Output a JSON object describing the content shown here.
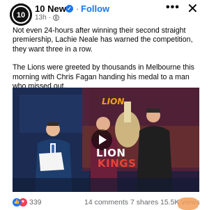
{
  "header": {
    "page_name": "10 News",
    "verified_mark": "✓",
    "separator": "·",
    "follow_label": "Follow",
    "timestamp": "13h",
    "timestamp_separator": "·",
    "logo_text": "10",
    "more_label": "•••",
    "close_label": "✕"
  },
  "post": {
    "paragraph_1": "Not even 24-hours after winning their second straight premiership, Lachie Neale has warned the competition, they want three in a row.",
    "paragraph_2": "The Lions were greeted by thousands in Melbourne this morning with Chris Fagan handing his medal to a man who missed out."
  },
  "media": {
    "logo_overlay": "LION",
    "title_line_1": "LION",
    "title_line_2": "KINGS",
    "accent_color": "#e8423a"
  },
  "footer": {
    "reaction_count": "339",
    "comments": "14 comments",
    "shares": "7 shares",
    "views": "15.5K views"
  },
  "colors": {
    "brand_blue": "#1877f2",
    "secondary_text": "#65676b"
  }
}
